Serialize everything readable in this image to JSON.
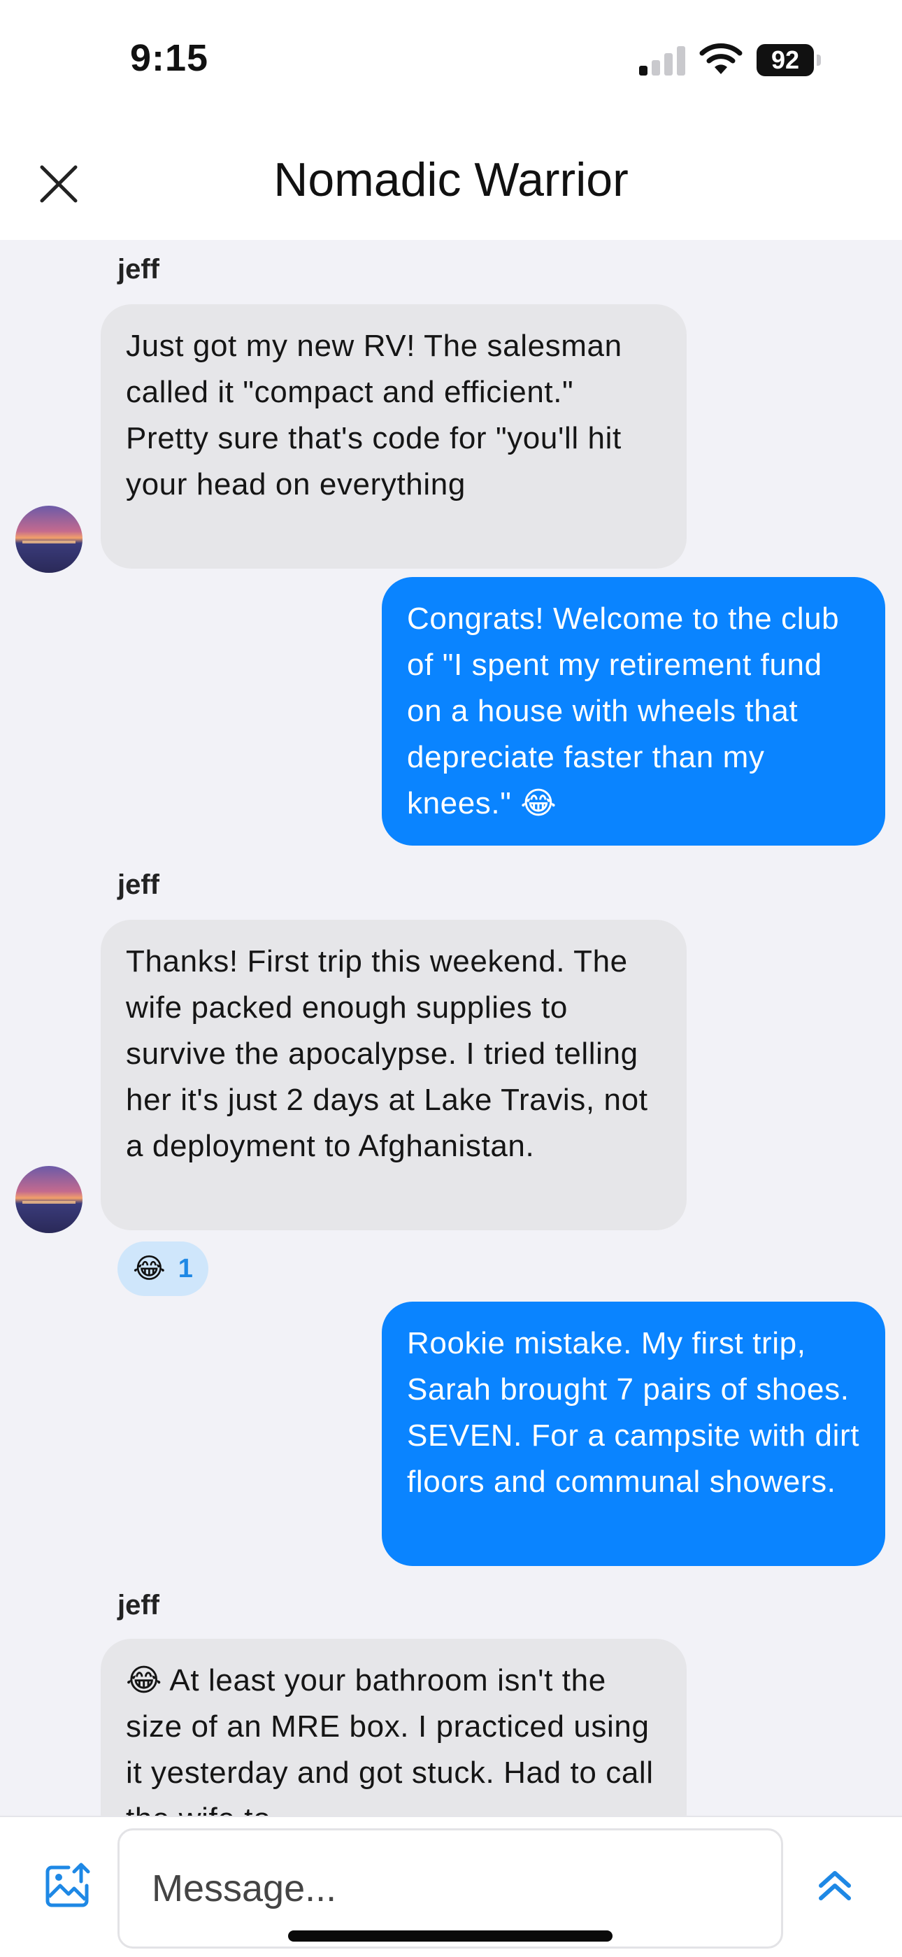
{
  "status_bar": {
    "time": "9:15",
    "battery": "92"
  },
  "header": {
    "title": "Nomadic Warrior"
  },
  "messages": [
    {
      "sender": "jeff",
      "text": "Just got my new RV! The salesman called it \"compact and efficient.\" Pretty sure that's code for \"you'll hit your head on everything"
    },
    {
      "text": "Congrats! Welcome to the club of \"I spent my retirement fund on a house with wheels that depreciate faster than my knees.\" 😂"
    },
    {
      "sender": "jeff",
      "text": "Thanks! First trip this weekend. The wife packed enough supplies to survive the apocalypse. I tried telling her it's just 2 days at Lake Travis, not a deployment to Afghanistan.",
      "reaction": {
        "emoji": "😂",
        "count": "1"
      }
    },
    {
      "text": "Rookie mistake. My first trip, Sarah brought 7 pairs of shoes. SEVEN. For a campsite with dirt floors and communal showers."
    },
    {
      "sender": "jeff",
      "text": "😂  At least your bathroom isn't the size of an MRE box. I practiced using it yesterday and got stuck. Had to call the wife to"
    }
  ],
  "composer": {
    "placeholder": "Message..."
  },
  "icons": {
    "close": "close-icon",
    "image_upload": "image-upload-icon",
    "expand": "chevron-up-double-icon",
    "signal": "cellular-signal-icon",
    "wifi": "wifi-icon",
    "battery": "battery-icon"
  },
  "colors": {
    "outgoing_bubble": "#0a84ff",
    "incoming_bubble": "#e6e6e9",
    "chat_background": "#f2f2f7",
    "reaction_background": "#cfe6fb"
  }
}
